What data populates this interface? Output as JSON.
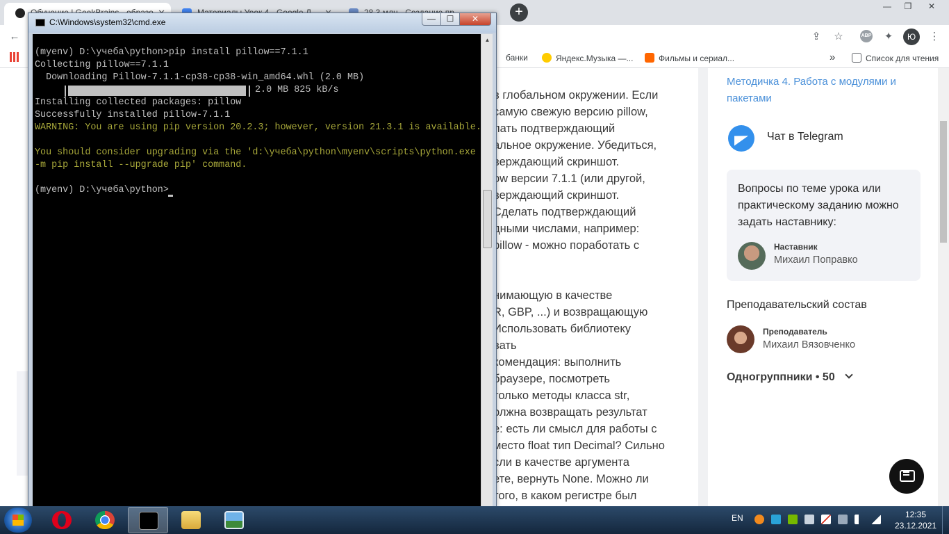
{
  "browser": {
    "tabs": [
      {
        "label": "Обучение | GeekBrains - образо..."
      },
      {
        "label": "Материалы Урок 4 - Google Д..."
      },
      {
        "label": "28.3 млн - Создание пр..."
      }
    ],
    "new_tab": "+",
    "window_buttons": {
      "minimize": "—",
      "restore": "❐",
      "close": "✕"
    },
    "toolbar": {
      "back": "←",
      "share": "⇪",
      "star": "☆",
      "abp": "ABP",
      "extensions": "✦",
      "profile": "Ю",
      "menu": "⋮"
    },
    "bookmarks": [
      {
        "label": "банки"
      },
      {
        "label": "Яндекс.Музыка —..."
      },
      {
        "label": "Фильмы и сериал..."
      }
    ],
    "bookmarks_more": "»",
    "reading_list": "Список для чтения"
  },
  "article": {
    "lines": [
      "в глобальном окружении. Если",
      "самую свежую версию pillow,",
      "лать подтверждающий",
      "альное окружение. Убедиться,",
      "верждающий скриншот.",
      "ow версии 7.1.1 (или другой,",
      "верждающий скриншот.",
      "Сделать подтверждающий",
      "дными числами, например:",
      "pillow - можно поработать с",
      "",
      "",
      "нимающую в качестве",
      "R, GBP, ...) и возвращающую",
      "Использовать библиотеку",
      "вать",
      "комендация: выполнить",
      "браузере, посмотреть",
      "только методы класса str,",
      "олжна возвращать результат",
      "е: есть ли смысл для работы с",
      "место float тип Decimal? Сильно",
      "сли в качестве аргумента",
      "ете, вернуть None. Можно ли",
      "того, в каком регистре был"
    ]
  },
  "sidebar": {
    "lesson_link": "Методичка 4. Работа с модулями и пакетами",
    "telegram_label": "Чат в Telegram",
    "mentor_card": {
      "text": "Вопросы по теме урока или практическому заданию можно задать наставнику:",
      "role": "Наставник",
      "name": "Михаил Поправко"
    },
    "teachers_title": "Преподавательский состав",
    "teacher": {
      "role": "Преподаватель",
      "name": "Михаил Вязовченко"
    },
    "classmates": "Одногруппники • 50"
  },
  "cmd": {
    "title": "C:\\Windows\\system32\\cmd.exe",
    "lines": [
      "(myenv) D:\\учеба\\python>pip install pillow==7.1.1",
      "Collecting pillow==7.1.1",
      "  Downloading Pillow-7.1.1-cp38-cp38-win_amd64.whl (2.0 MB)",
      "",
      "Installing collected packages: pillow",
      "Successfully installed pillow-7.1.1",
      "",
      "",
      "-m pip install --upgrade pip' command.",
      "",
      "(myenv) D:\\учеба\\python>"
    ],
    "progress_text": "2.0 MB 825 kB/s",
    "progress": 1.0,
    "warning_lines": [
      "WARNING: You are using pip version 20.2.3; however, version 21.3.1 is available.",
      "You should consider upgrading via the 'd:\\учеба\\python\\myenv\\scripts\\python.exe"
    ],
    "window_buttons": {
      "minimize": "—",
      "maximize": "☐",
      "close": "✕"
    }
  },
  "taskbar": {
    "language": "EN",
    "time": "12:35",
    "date": "23.12.2021"
  }
}
